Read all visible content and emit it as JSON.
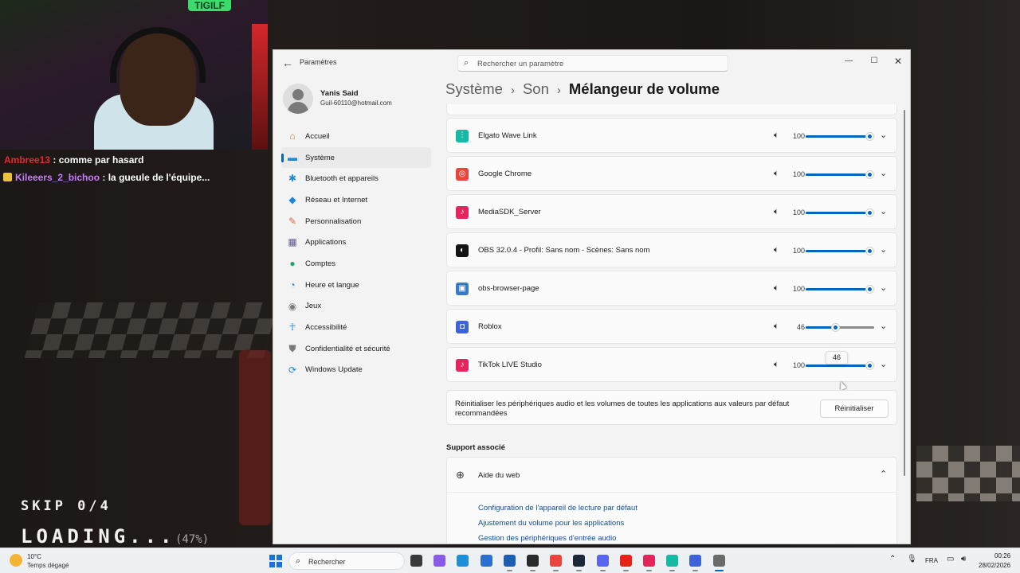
{
  "stream": {
    "webcam_sign": "TIGILF",
    "chat": [
      {
        "user": "Ambree13",
        "message": " : comme par hasard"
      },
      {
        "user": "Kileeers_2_bichoo",
        "message": " : la gueule de l'équipe..."
      }
    ],
    "skip_text": "SKIP 0/4",
    "loading_text": "LOADING...",
    "loading_percent": "(47%)"
  },
  "window": {
    "app_title": "Paramètres",
    "search_placeholder": "Rechercher un paramètre",
    "controls": {
      "minimize": "—",
      "maximize": "☐",
      "close": "✕"
    },
    "back": "←"
  },
  "profile": {
    "name": "Yanis Said",
    "email": "Guil-60110@hotmail.com"
  },
  "sidebar": {
    "items": [
      {
        "label": "Accueil",
        "icon": "home-icon",
        "glyph": "⌂",
        "color": "#e07a2e"
      },
      {
        "label": "Système",
        "icon": "system-icon",
        "glyph": "▬",
        "color": "#1f88d6",
        "active": true
      },
      {
        "label": "Bluetooth et appareils",
        "icon": "bluetooth-icon",
        "glyph": "✱",
        "color": "#1f88d6"
      },
      {
        "label": "Réseau et Internet",
        "icon": "network-icon",
        "glyph": "◆",
        "color": "#1f88d6"
      },
      {
        "label": "Personnalisation",
        "icon": "brush-icon",
        "glyph": "✎",
        "color": "#d6693a"
      },
      {
        "label": "Applications",
        "icon": "apps-icon",
        "glyph": "▦",
        "color": "#5a5a8a"
      },
      {
        "label": "Comptes",
        "icon": "accounts-icon",
        "glyph": "●",
        "color": "#28a36a"
      },
      {
        "label": "Heure et langue",
        "icon": "clock-globe-icon",
        "glyph": "◔",
        "color": "#1f88d6"
      },
      {
        "label": "Jeux",
        "icon": "gamepad-icon",
        "glyph": "◉",
        "color": "#7a7a7a"
      },
      {
        "label": "Accessibilité",
        "icon": "accessibility-icon",
        "glyph": "☥",
        "color": "#1f88d6"
      },
      {
        "label": "Confidentialité et sécurité",
        "icon": "shield-icon",
        "glyph": "⛊",
        "color": "#7a7a7a"
      },
      {
        "label": "Windows Update",
        "icon": "windows-update-icon",
        "glyph": "⟳",
        "color": "#1f88d6"
      }
    ]
  },
  "breadcrumb": {
    "level1": "Système",
    "level2": "Son",
    "current": "Mélangeur de volume",
    "separator": "›"
  },
  "mixer": {
    "apps": [
      {
        "name": "Elgato Wave Link",
        "icon": "wave-link-icon",
        "glyph": "⫶",
        "color": "#16b9a4",
        "volume": 100,
        "volume_display": "100"
      },
      {
        "name": "Google Chrome",
        "icon": "chrome-icon",
        "glyph": "◎",
        "color": "#e8453c",
        "volume": 100,
        "volume_display": "100"
      },
      {
        "name": "MediaSDK_Server",
        "icon": "tiktok-icon",
        "glyph": "♪",
        "color": "#e6245c",
        "volume": 100,
        "volume_display": "100"
      },
      {
        "name": "OBS 32.0.4 - Profil: Sans nom - Scènes: Sans nom",
        "icon": "obs-icon",
        "glyph": "◐",
        "color": "#141414",
        "volume": 100,
        "volume_display": "100"
      },
      {
        "name": "obs-browser-page",
        "icon": "window-icon",
        "glyph": "▣",
        "color": "#3a7bc8",
        "volume": 100,
        "volume_display": "100"
      },
      {
        "name": "Roblox",
        "icon": "roblox-icon",
        "glyph": "◘",
        "color": "#3e63d8",
        "volume": 46,
        "volume_display": "46"
      },
      {
        "name": "TikTok LIVE Studio",
        "icon": "tiktok-icon",
        "glyph": "♪",
        "color": "#e6245c",
        "volume": 100,
        "volume_display": "100"
      }
    ],
    "tooltip": "46",
    "reset_text": "Réinitialiser les périphériques audio et les volumes de toutes les applications aux valeurs par défaut recommandées",
    "reset_button": "Réinitialiser"
  },
  "support": {
    "heading": "Support associé",
    "help_title": "Aide du web",
    "links": [
      "Configuration de l'appareil de lecture par défaut",
      "Ajustement du volume pour les applications",
      "Gestion des périphériques d'entrée audio"
    ]
  },
  "taskbar": {
    "temperature": "10°C",
    "weather": "Temps dégagé",
    "search_label": "Rechercher",
    "apps": [
      {
        "icon": "task-view-icon",
        "color": "#3a3a3a"
      },
      {
        "icon": "copilot-icon",
        "color": "#8a5be8"
      },
      {
        "icon": "edge-icon",
        "color": "#1b8fd8"
      },
      {
        "icon": "store-icon",
        "color": "#2b6fd0"
      },
      {
        "icon": "outlook-icon",
        "color": "#1a5fb4"
      },
      {
        "icon": "obs-icon",
        "color": "#2a2a2a"
      },
      {
        "icon": "chrome-icon",
        "color": "#e8453c"
      },
      {
        "icon": "steam-icon",
        "color": "#1b2838"
      },
      {
        "icon": "discord-icon",
        "color": "#5865f2"
      },
      {
        "icon": "youtube-icon",
        "color": "#e62117"
      },
      {
        "icon": "tiktok-icon",
        "color": "#e6245c"
      },
      {
        "icon": "wave-link-icon",
        "color": "#16b9a4"
      },
      {
        "icon": "roblox-icon",
        "color": "#3e63d8"
      },
      {
        "icon": "settings-icon",
        "color": "#6a6a6a"
      }
    ],
    "language": "FRA",
    "time": "00:26",
    "date": "28/02/2026"
  },
  "colors": {
    "accent": "#0067c0",
    "window_bg": "#f3f3f3",
    "card_bg": "#fbfbfb"
  }
}
